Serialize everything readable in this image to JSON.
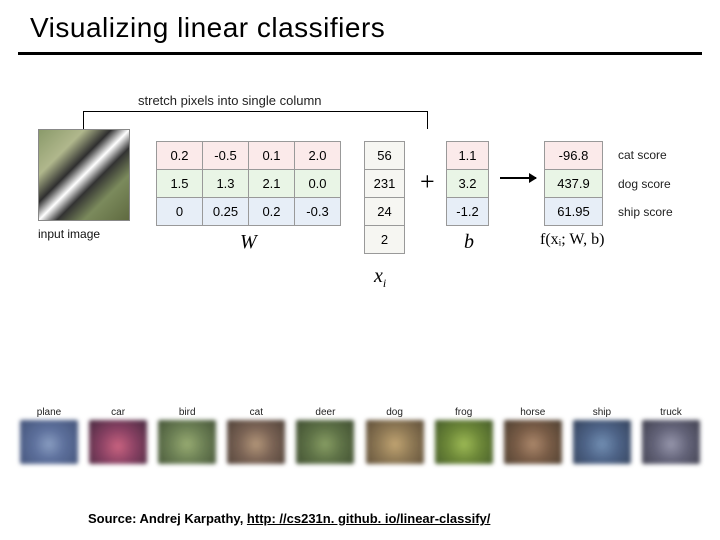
{
  "title": "Visualizing linear classifiers",
  "stretch_label": "stretch pixels into single column",
  "input_label": "input image",
  "W": [
    [
      "0.2",
      "-0.5",
      "0.1",
      "2.0"
    ],
    [
      "1.5",
      "1.3",
      "2.1",
      "0.0"
    ],
    [
      "0",
      "0.25",
      "0.2",
      "-0.3"
    ]
  ],
  "xi": [
    "56",
    "231",
    "24",
    "2"
  ],
  "b": [
    "1.1",
    "3.2",
    "-1.2"
  ],
  "f": [
    "-96.8",
    "437.9",
    "61.95"
  ],
  "symbols": {
    "W": "W",
    "xi": "x",
    "xi_sub": "i",
    "b": "b",
    "plus": "+",
    "f": "f(xᵢ; W, b)"
  },
  "scores": {
    "cat": "cat score",
    "dog": "dog score",
    "ship": "ship score"
  },
  "vis_classes": [
    {
      "label": "plane",
      "bg": "radial-gradient(circle at 50% 55%, #8aa0c8 0%, #5a6fa0 40%, #3c4e78 100%)"
    },
    {
      "label": "car",
      "bg": "radial-gradient(circle at 50% 60%, #d26080 0%, #8a3a60 45%, #402038 100%)"
    },
    {
      "label": "bird",
      "bg": "radial-gradient(circle at 50% 55%, #9ab070 0%, #6a8050 45%, #3f5030 100%)"
    },
    {
      "label": "cat",
      "bg": "radial-gradient(circle at 50% 55%, #b89878 0%, #7a6050 45%, #4a3a30 100%)"
    },
    {
      "label": "deer",
      "bg": "radial-gradient(circle at 50% 55%, #88a060 0%, #5a7040 45%, #384828 100%)"
    },
    {
      "label": "dog",
      "bg": "radial-gradient(circle at 50% 55%, #c8a870 0%, #907850 45%, #5a4830 100%)"
    },
    {
      "label": "frog",
      "bg": "radial-gradient(circle at 50% 55%, #a0c050 0%, #6a8830 45%, #3f5820 100%)"
    },
    {
      "label": "horse",
      "bg": "radial-gradient(circle at 50% 55%, #b08868 0%, #785840 45%, #483828 100%)"
    },
    {
      "label": "ship",
      "bg": "radial-gradient(circle at 50% 55%, #7090b8 0%, #486088 45%, #2c3c58 100%)"
    },
    {
      "label": "truck",
      "bg": "radial-gradient(circle at 50% 55%, #9898b0 0%, #606078 45%, #3a3a4a 100%)"
    }
  ],
  "source": {
    "prefix": "Source: Andrej Karpathy, ",
    "url": "http: //cs231n. github. io/linear-classify/"
  }
}
